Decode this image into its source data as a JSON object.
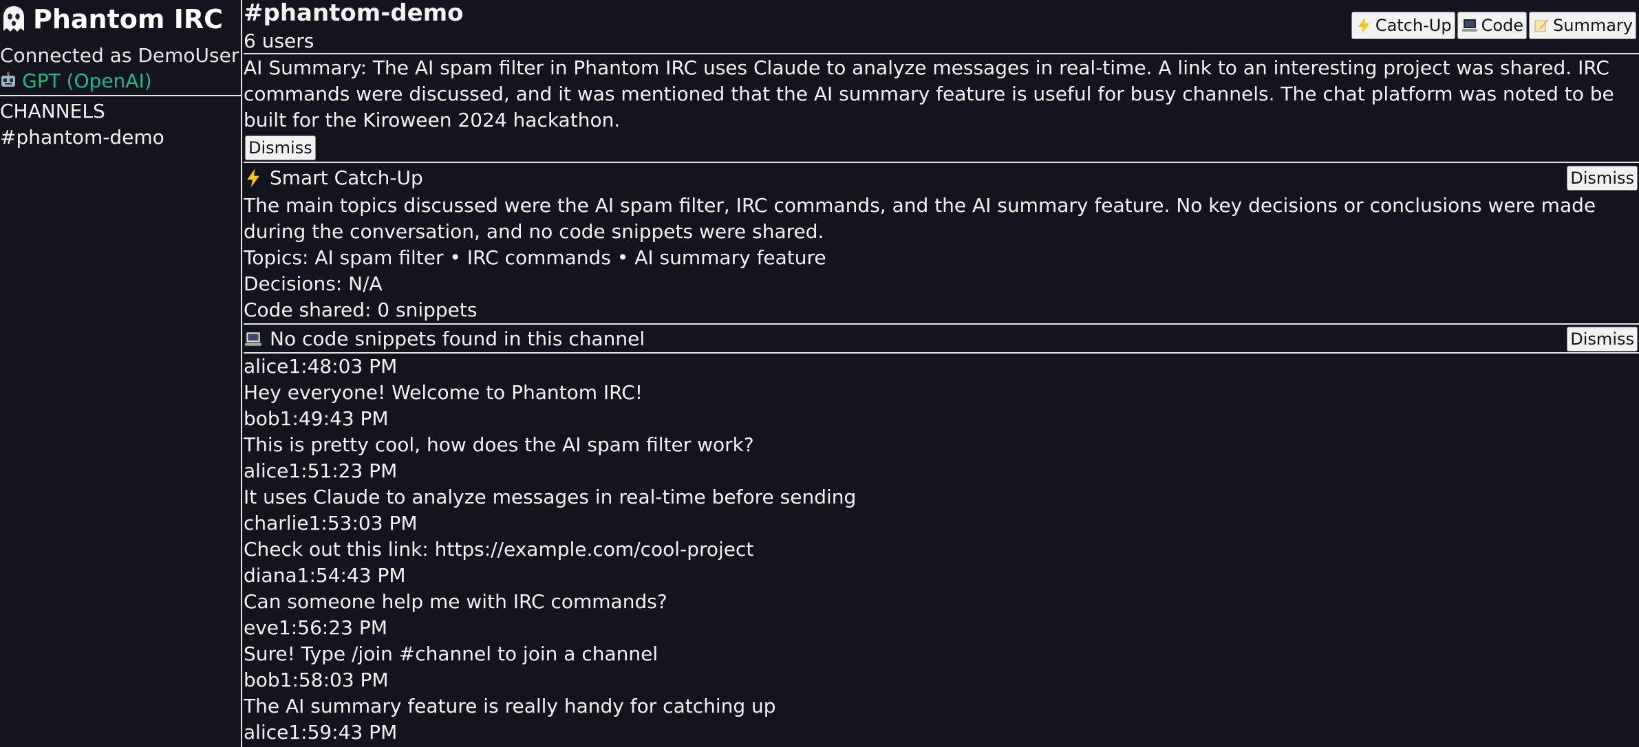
{
  "sidebar": {
    "app_title": "Phantom IRC",
    "app_icon": "ghost-icon",
    "connected_text": "Connected as DemoUser",
    "model_label": "GPT (OpenAI)",
    "model_icon": "robot-icon",
    "model_color": "#21b985",
    "channels_heading": "CHANNELS",
    "channels": [
      {
        "name": "#phantom-demo"
      }
    ]
  },
  "header": {
    "channel_name": "#phantom-demo",
    "user_count": "6 users",
    "buttons": {
      "catchup": {
        "icon": "lightning-icon",
        "label": "Catch-Up"
      },
      "code": {
        "icon": "laptop-icon",
        "label": "Code"
      },
      "summary": {
        "icon": "memo-icon",
        "label": "Summary"
      }
    }
  },
  "ai_summary": {
    "text": "AI Summary: The AI spam filter in Phantom IRC uses Claude to analyze messages in real-time. A link to an interesting project was shared. IRC commands were discussed, and it was mentioned that the AI summary feature is useful for busy channels. The chat platform was noted to be built for the Kiroween 2024 hackathon.",
    "dismiss_label": "Dismiss"
  },
  "catchup": {
    "icon": "lightning-icon",
    "title": "Smart Catch-Up",
    "dismiss_label": "Dismiss",
    "body": "The main topics discussed were the AI spam filter, IRC commands, and the AI summary feature. No key decisions or conclusions were made during the conversation, and no code snippets were shared.",
    "topics": "Topics: AI spam filter • IRC commands • AI summary feature",
    "decisions": "Decisions: N/A",
    "code_shared": "Code shared: 0 snippets"
  },
  "code_panel": {
    "icon": "laptop-icon",
    "title": "No code snippets found in this channel",
    "dismiss_label": "Dismiss"
  },
  "messages": [
    {
      "user": "alice",
      "time": "1:48:03 PM",
      "text": "Hey everyone! Welcome to Phantom IRC!"
    },
    {
      "user": "bob",
      "time": "1:49:43 PM",
      "text": "This is pretty cool, how does the AI spam filter work?"
    },
    {
      "user": "alice",
      "time": "1:51:23 PM",
      "text": "It uses Claude to analyze messages in real-time before sending"
    },
    {
      "user": "charlie",
      "time": "1:53:03 PM",
      "text": "Check out this link: https://example.com/cool-project"
    },
    {
      "user": "diana",
      "time": "1:54:43 PM",
      "text": "Can someone help me with IRC commands?"
    },
    {
      "user": "eve",
      "time": "1:56:23 PM",
      "text": "Sure! Type /join #channel to join a channel"
    },
    {
      "user": "bob",
      "time": "1:58:03 PM",
      "text": "The AI summary feature is really handy for catching up"
    },
    {
      "user": "alice",
      "time": "1:59:43 PM",
      "text": ""
    }
  ]
}
